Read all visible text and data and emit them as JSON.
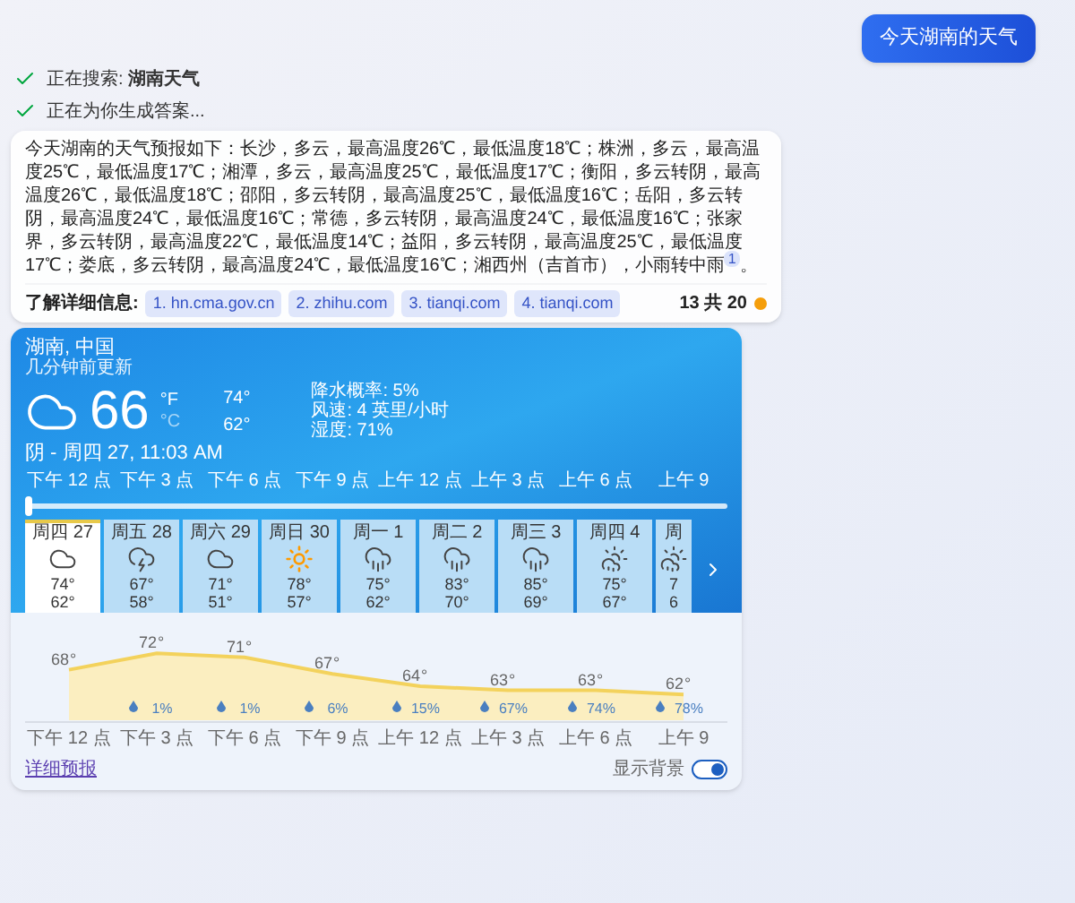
{
  "user_message": "今天湖南的天气",
  "progress": [
    {
      "label": "正在搜索: ",
      "query": "湖南天气",
      "done": true
    },
    {
      "label": "正在为你生成答案...",
      "done": true
    }
  ],
  "answer": {
    "text": "今天湖南的天气预报如下：长沙，多云，最高温度26℃，最低温度18℃；株洲，多云，最高温度25℃，最低温度17℃；湘潭，多云，最高温度25℃，最低温度17℃；衡阳，多云转阴，最高温度26℃，最低温度18℃；邵阳，多云转阴，最高温度25℃，最低温度16℃；岳阳，多云转阴，最高温度24℃，最低温度16℃；常德，多云转阴，最高温度24℃，最低温度16℃；张家界，多云转阴，最高温度22℃，最低温度14℃；益阳，多云转阴，最高温度25℃，最低温度17℃；娄底，多云转阴，最高温度24℃，最低温度16℃；湘西州（吉首市），小雨转中雨",
    "citation": "1",
    "tail": "。",
    "sources_label": "了解详细信息:",
    "sources": [
      "1. hn.cma.gov.cn",
      "2. zhihu.com",
      "3. tianqi.com",
      "4. tianqi.com"
    ],
    "count": "13 共 20"
  },
  "weather": {
    "location": "湖南, 中国",
    "updated": "几分钟前更新",
    "kind": "cloudy",
    "temp": "66",
    "units": [
      {
        "label": "°F",
        "selected": true
      },
      {
        "label": "°C",
        "selected": false
      }
    ],
    "high": "74°",
    "low": "62°",
    "details": [
      "降水概率: 5%",
      "风速: 4 英里/小时",
      "湿度: 71%"
    ],
    "condition": "阴 - 周四 27, 11:03 AM",
    "timeline": {
      "labels": [
        "下午 12 点",
        "下午 3 点",
        "下午 6 点",
        "下午 9 点",
        "上午 12 点",
        "上午 3 点",
        "上午 6 点",
        "上午 9"
      ],
      "level": 0
    },
    "days": [
      {
        "day": "周四 27",
        "kind": "cloudy",
        "high": "74°",
        "low": "62°",
        "selected": true
      },
      {
        "day": "周五 28",
        "kind": "thunder",
        "high": "67°",
        "low": "58°",
        "selected": false
      },
      {
        "day": "周六 29",
        "kind": "cloudy",
        "high": "71°",
        "low": "51°",
        "selected": false
      },
      {
        "day": "周日 30",
        "kind": "sunny",
        "high": "78°",
        "low": "57°",
        "selected": false
      },
      {
        "day": "周一 1",
        "kind": "rain",
        "high": "75°",
        "low": "62°",
        "selected": false
      },
      {
        "day": "周二 2",
        "kind": "rain",
        "high": "83°",
        "low": "70°",
        "selected": false
      },
      {
        "day": "周三 3",
        "kind": "rain",
        "high": "85°",
        "low": "69°",
        "selected": false
      },
      {
        "day": "周四 4",
        "kind": "sun-rain",
        "high": "75°",
        "low": "67°",
        "selected": false
      },
      {
        "day": "周",
        "kind": "sun-rain",
        "high": "7",
        "low": "6",
        "selected": false
      }
    ],
    "hourly": {
      "chart_data": {
        "type": "area",
        "categories": [
          "下午 12 点",
          "下午 3 点",
          "下午 6 点",
          "下午 9 点",
          "上午 12 点",
          "上午 3 点",
          "上午 6 点",
          "上午 9"
        ],
        "series": [
          {
            "color": "#f3d25c",
            "values": [
              68,
              72,
              71,
              67,
              64,
              63,
              63,
              62
            ]
          }
        ],
        "data_labels": true
      },
      "label_suffix": "°",
      "precip": [
        "1%",
        "1%",
        "6%",
        "15%",
        "67%",
        "74%",
        "78%"
      ]
    },
    "footer_link": "详细预报",
    "background_toggle": {
      "label": "显示背景",
      "on": true
    }
  }
}
